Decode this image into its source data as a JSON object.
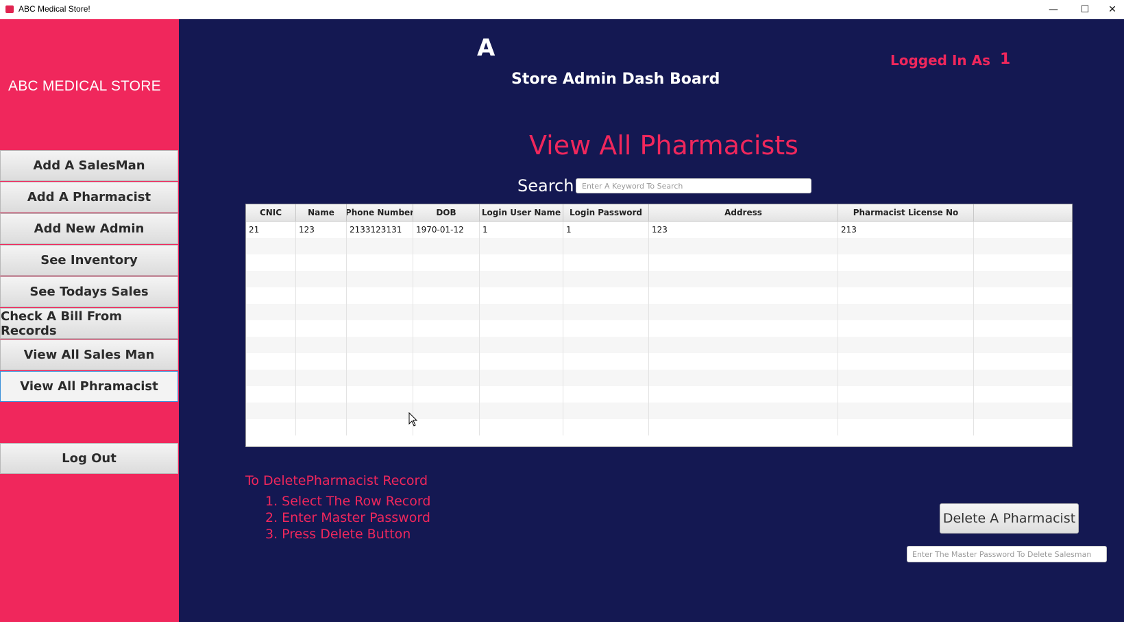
{
  "window": {
    "title": "ABC Medical Store!",
    "minimize": "—",
    "maximize": "☐",
    "close": "✕"
  },
  "sidebar": {
    "brand": "ABC MEDICAL STORE",
    "items": [
      {
        "label": "Add A SalesMan"
      },
      {
        "label": "Add A Pharmacist"
      },
      {
        "label": "Add New Admin"
      },
      {
        "label": "See Inventory"
      },
      {
        "label": "See Todays Sales"
      },
      {
        "label": "Check A Bill From Records"
      },
      {
        "label": "View All Sales Man"
      },
      {
        "label": "View All  Phramacist"
      }
    ],
    "logout": "Log Out"
  },
  "header": {
    "logo_letter": "A",
    "dashboard_title": "Store Admin Dash Board",
    "logged_in_label": "Logged In As",
    "logged_in_user": "1"
  },
  "main": {
    "title": "View All Pharmacists",
    "search_label": "Search",
    "search_placeholder": "Enter A Keyword To Search",
    "table": {
      "columns": [
        "CNIC",
        "Name",
        "Phone Number",
        "DOB",
        "Login User Name",
        "Login Password",
        "Address",
        "Pharmacist License No",
        ""
      ],
      "rows": [
        [
          "21",
          "123",
          "2133123131",
          "1970-01-12",
          "1",
          "1",
          "123",
          "213",
          ""
        ]
      ]
    },
    "instructions": {
      "title": "To DeletePharmacist Record",
      "steps": [
        "1. Select The Row Record",
        "2. Enter Master Password",
        "3. Press Delete Button"
      ]
    },
    "delete_button": "Delete A Pharmacist",
    "master_password_placeholder": "Enter The Master Password To Delete Salesman"
  }
}
